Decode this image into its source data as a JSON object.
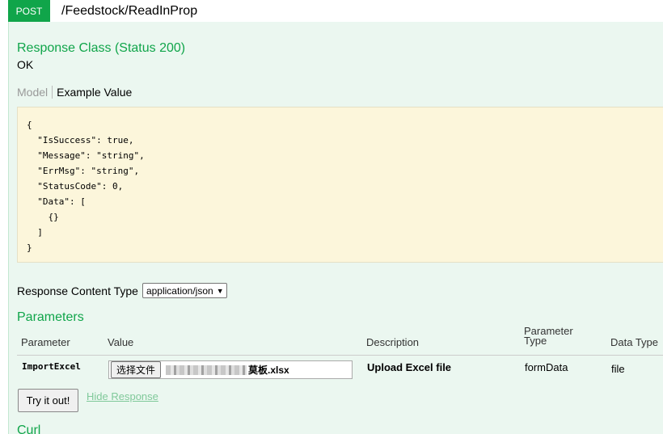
{
  "operation": {
    "method": "POST",
    "path": "/Feedstock/ReadInProp"
  },
  "response_class": {
    "title": "Response Class (Status 200)",
    "status_text": "OK"
  },
  "model_tabs": {
    "model": "Model",
    "example": "Example Value"
  },
  "example_value": "{\n  \"IsSuccess\": true,\n  \"Message\": \"string\",\n  \"ErrMsg\": \"string\",\n  \"StatusCode\": 0,\n  \"Data\": [\n    {}\n  ]\n}",
  "response_content_type": {
    "label": "Response Content Type",
    "selected": "application/json"
  },
  "parameters": {
    "title": "Parameters",
    "headers": {
      "parameter": "Parameter",
      "value": "Value",
      "description": "Description",
      "parameter_type": "Parameter\nType",
      "data_type": "Data Type"
    },
    "rows": [
      {
        "name": "ImportExcel",
        "file_button": "选择文件",
        "file_name_suffix": "莫板.xlsx",
        "description": "Upload Excel file",
        "parameter_type": "formData",
        "data_type": "file"
      }
    ]
  },
  "actions": {
    "try_it_out": "Try it out!",
    "hide_response": "Hide Response"
  },
  "curl": {
    "title": "Curl"
  },
  "colors": {
    "method_post": "#10a54a",
    "section_title": "#10a54a",
    "panel_bg": "#ebf7f0",
    "code_bg": "#fcf6db",
    "link": "#80c99a"
  }
}
